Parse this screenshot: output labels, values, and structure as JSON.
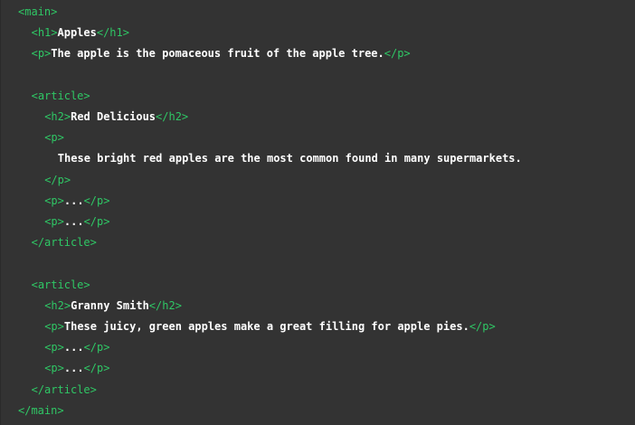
{
  "code_lines": [
    {
      "indent": 0,
      "parts": [
        {
          "t": "tag",
          "v": "<main>"
        }
      ]
    },
    {
      "indent": 1,
      "parts": [
        {
          "t": "tag",
          "v": "<h1>"
        },
        {
          "t": "txt",
          "v": "Apples"
        },
        {
          "t": "tag",
          "v": "</h1>"
        }
      ]
    },
    {
      "indent": 1,
      "parts": [
        {
          "t": "tag",
          "v": "<p>"
        },
        {
          "t": "txt",
          "v": "The apple is the pomaceous fruit of the apple tree."
        },
        {
          "t": "tag",
          "v": "</p>"
        }
      ]
    },
    {
      "indent": 0,
      "parts": []
    },
    {
      "indent": 1,
      "parts": [
        {
          "t": "tag",
          "v": "<article>"
        }
      ]
    },
    {
      "indent": 2,
      "parts": [
        {
          "t": "tag",
          "v": "<h2>"
        },
        {
          "t": "txt",
          "v": "Red Delicious"
        },
        {
          "t": "tag",
          "v": "</h2>"
        }
      ]
    },
    {
      "indent": 2,
      "parts": [
        {
          "t": "tag",
          "v": "<p>"
        }
      ]
    },
    {
      "indent": 3,
      "parts": [
        {
          "t": "txt",
          "v": "These bright red apples are the most common found in many supermarkets."
        }
      ]
    },
    {
      "indent": 2,
      "parts": [
        {
          "t": "tag",
          "v": "</p>"
        }
      ]
    },
    {
      "indent": 2,
      "parts": [
        {
          "t": "tag",
          "v": "<p>"
        },
        {
          "t": "txt",
          "v": "..."
        },
        {
          "t": "tag",
          "v": "</p>"
        }
      ]
    },
    {
      "indent": 2,
      "parts": [
        {
          "t": "tag",
          "v": "<p>"
        },
        {
          "t": "txt",
          "v": "..."
        },
        {
          "t": "tag",
          "v": "</p>"
        }
      ]
    },
    {
      "indent": 1,
      "parts": [
        {
          "t": "tag",
          "v": "</article>"
        }
      ]
    },
    {
      "indent": 0,
      "parts": []
    },
    {
      "indent": 1,
      "parts": [
        {
          "t": "tag",
          "v": "<article>"
        }
      ]
    },
    {
      "indent": 2,
      "parts": [
        {
          "t": "tag",
          "v": "<h2>"
        },
        {
          "t": "txt",
          "v": "Granny Smith"
        },
        {
          "t": "tag",
          "v": "</h2>"
        }
      ]
    },
    {
      "indent": 2,
      "parts": [
        {
          "t": "tag",
          "v": "<p>"
        },
        {
          "t": "txt",
          "v": "These juicy, green apples make a great filling for apple pies."
        },
        {
          "t": "tag",
          "v": "</p>"
        }
      ]
    },
    {
      "indent": 2,
      "parts": [
        {
          "t": "tag",
          "v": "<p>"
        },
        {
          "t": "txt",
          "v": "..."
        },
        {
          "t": "tag",
          "v": "</p>"
        }
      ]
    },
    {
      "indent": 2,
      "parts": [
        {
          "t": "tag",
          "v": "<p>"
        },
        {
          "t": "txt",
          "v": "..."
        },
        {
          "t": "tag",
          "v": "</p>"
        }
      ]
    },
    {
      "indent": 1,
      "parts": [
        {
          "t": "tag",
          "v": "</article>"
        }
      ]
    },
    {
      "indent": 0,
      "parts": [
        {
          "t": "tag",
          "v": "</main>"
        }
      ]
    }
  ]
}
